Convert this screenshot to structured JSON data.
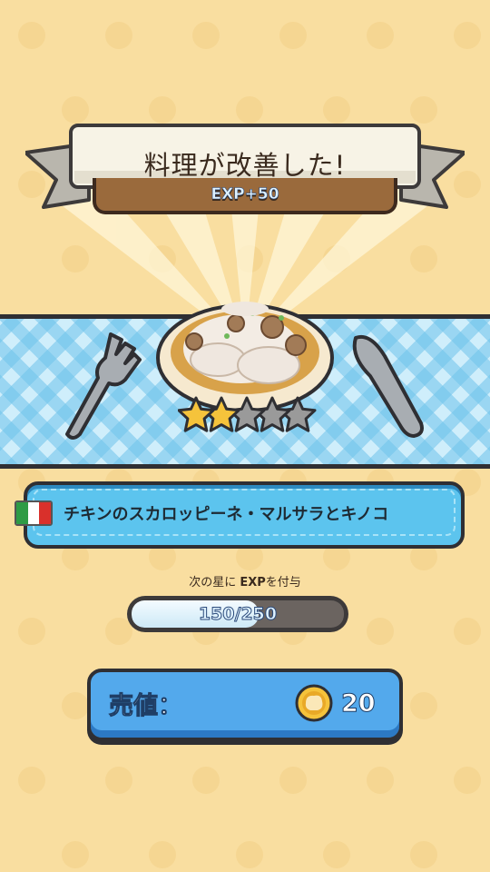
{
  "banner": {
    "title": "料理が改善した!",
    "exp_gain": "EXP+50"
  },
  "dish": {
    "stars_earned": 2,
    "stars_total": 5,
    "name": "チキンのスカロッピーネ・マルサラとキノコ",
    "flag": "italy-flag",
    "flag_colors": [
      "#2e9b45",
      "#ffffff",
      "#d9302b"
    ]
  },
  "progress": {
    "label_prefix": "次の星に",
    "label_exp": "EXP",
    "label_suffix": "を付与",
    "current": 150,
    "max": 250,
    "text": "150/250"
  },
  "price": {
    "label": "売値：",
    "value": "20",
    "icon": "coin-icon"
  },
  "colors": {
    "background": "#f9dea0",
    "accent_blue": "#53a9ec",
    "dish_bar": "#5cc4ee",
    "star_gold": "#f5c33b",
    "star_gray": "#9a9a9a"
  }
}
